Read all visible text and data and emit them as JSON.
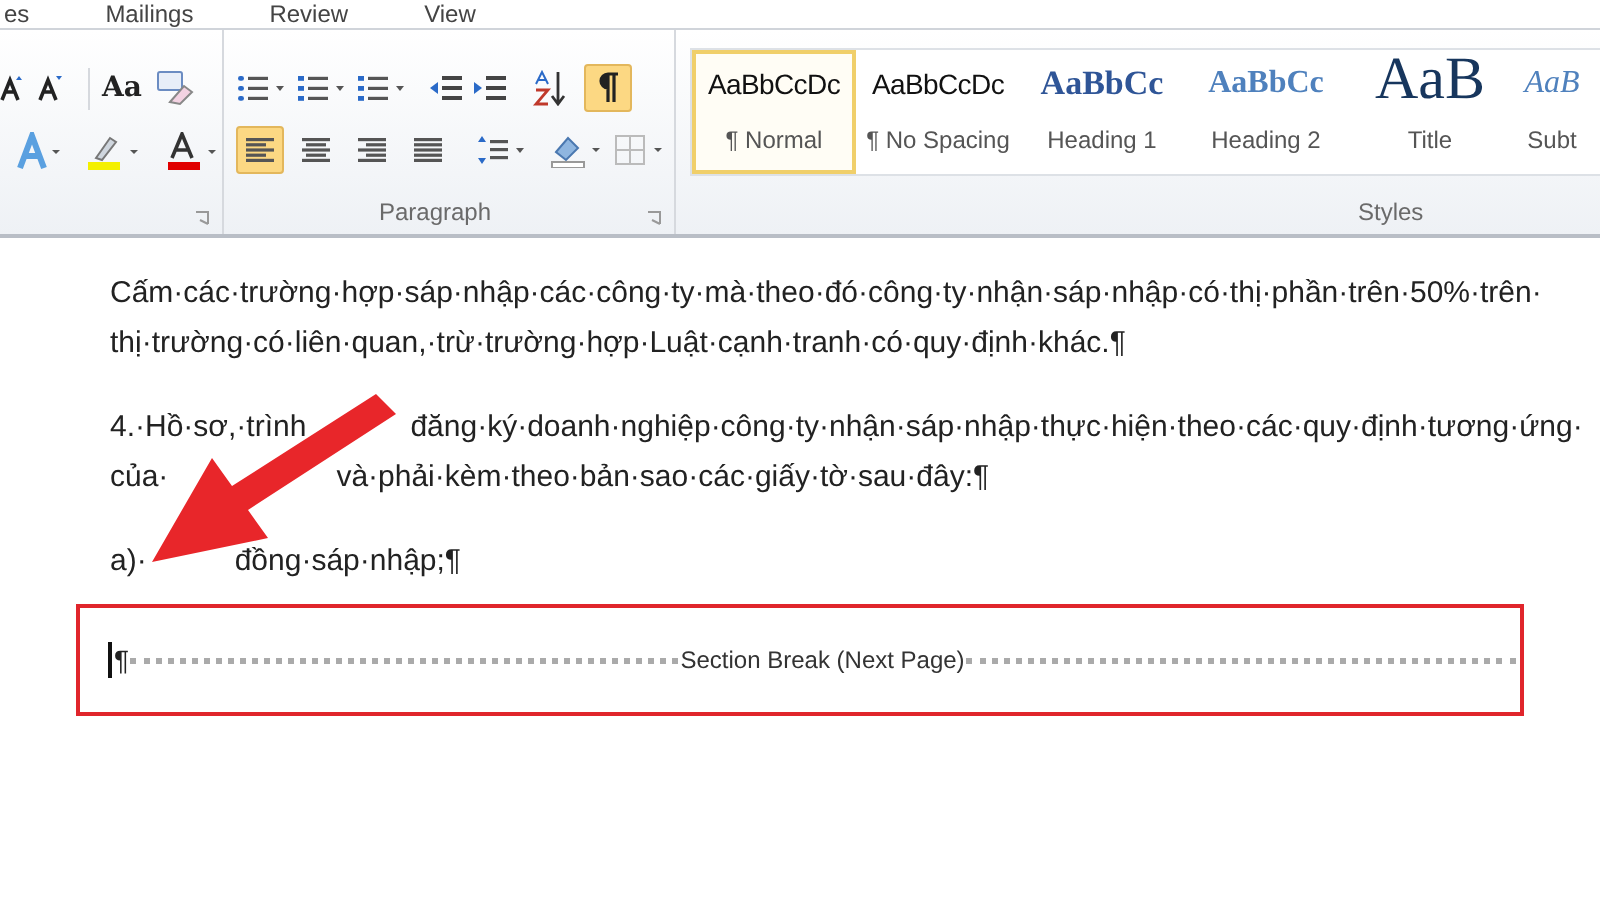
{
  "menu_tabs": [
    "es",
    "Mailings",
    "Review",
    "View"
  ],
  "ribbon": {
    "font_group": {
      "change_case": "Aa"
    },
    "paragraph_group": {
      "label": "Paragraph",
      "show_marks": {
        "selected": true
      },
      "alignments": [
        {
          "kind": "left",
          "selected": true
        },
        {
          "kind": "center",
          "selected": false
        },
        {
          "kind": "right",
          "selected": false
        },
        {
          "kind": "justify",
          "selected": false
        }
      ]
    },
    "styles_group": {
      "label": "Styles",
      "styles": [
        {
          "kind": "normal",
          "sample": "AaBbCcDc",
          "name": "¶ Normal",
          "selected": true
        },
        {
          "kind": "normal",
          "sample": "AaBbCcDc",
          "name": "¶ No Spacing",
          "selected": false
        },
        {
          "kind": "heading1",
          "sample": "AaBbCc",
          "name": "Heading 1",
          "selected": false
        },
        {
          "kind": "heading2",
          "sample": "AaBbCc",
          "name": "Heading 2",
          "selected": false
        },
        {
          "kind": "title",
          "sample": "AaB",
          "name": "Title",
          "selected": false
        },
        {
          "kind": "subtitle",
          "sample": "AaB",
          "name": "Subt",
          "selected": false
        }
      ]
    }
  },
  "document": {
    "paragraphs": [
      {
        "lines": [
          [
            "Cấm·các·trường·hợp·sáp·nhập·các·công·ty·mà·theo·đó·công·ty·nhận·sáp·nhập·có·thị·phần·trên·50%·trên·"
          ],
          [
            "thị·trường·có·liên·quan,·trừ·trường·hợp·Luật·cạnh·tranh·có·quy·định·khác.¶"
          ]
        ]
      },
      {
        "lines": [
          [
            "4.·Hồ·sơ,·trình",
            "đăng·ký·doanh·nghiệp·công·ty·nhận·sáp·nhập·thực·hiện·theo·các·quy·định·tương·ứng·"
          ],
          [
            "của·",
            "và·phải·kèm·theo·bản·sao·các·giấy·tờ·sau·đây:¶"
          ]
        ]
      },
      {
        "lines": [
          [
            "a)·",
            "đồng·sáp·nhập;¶"
          ]
        ]
      }
    ],
    "section_break": {
      "mark": "¶",
      "label": "Section Break (Next Page)"
    }
  }
}
